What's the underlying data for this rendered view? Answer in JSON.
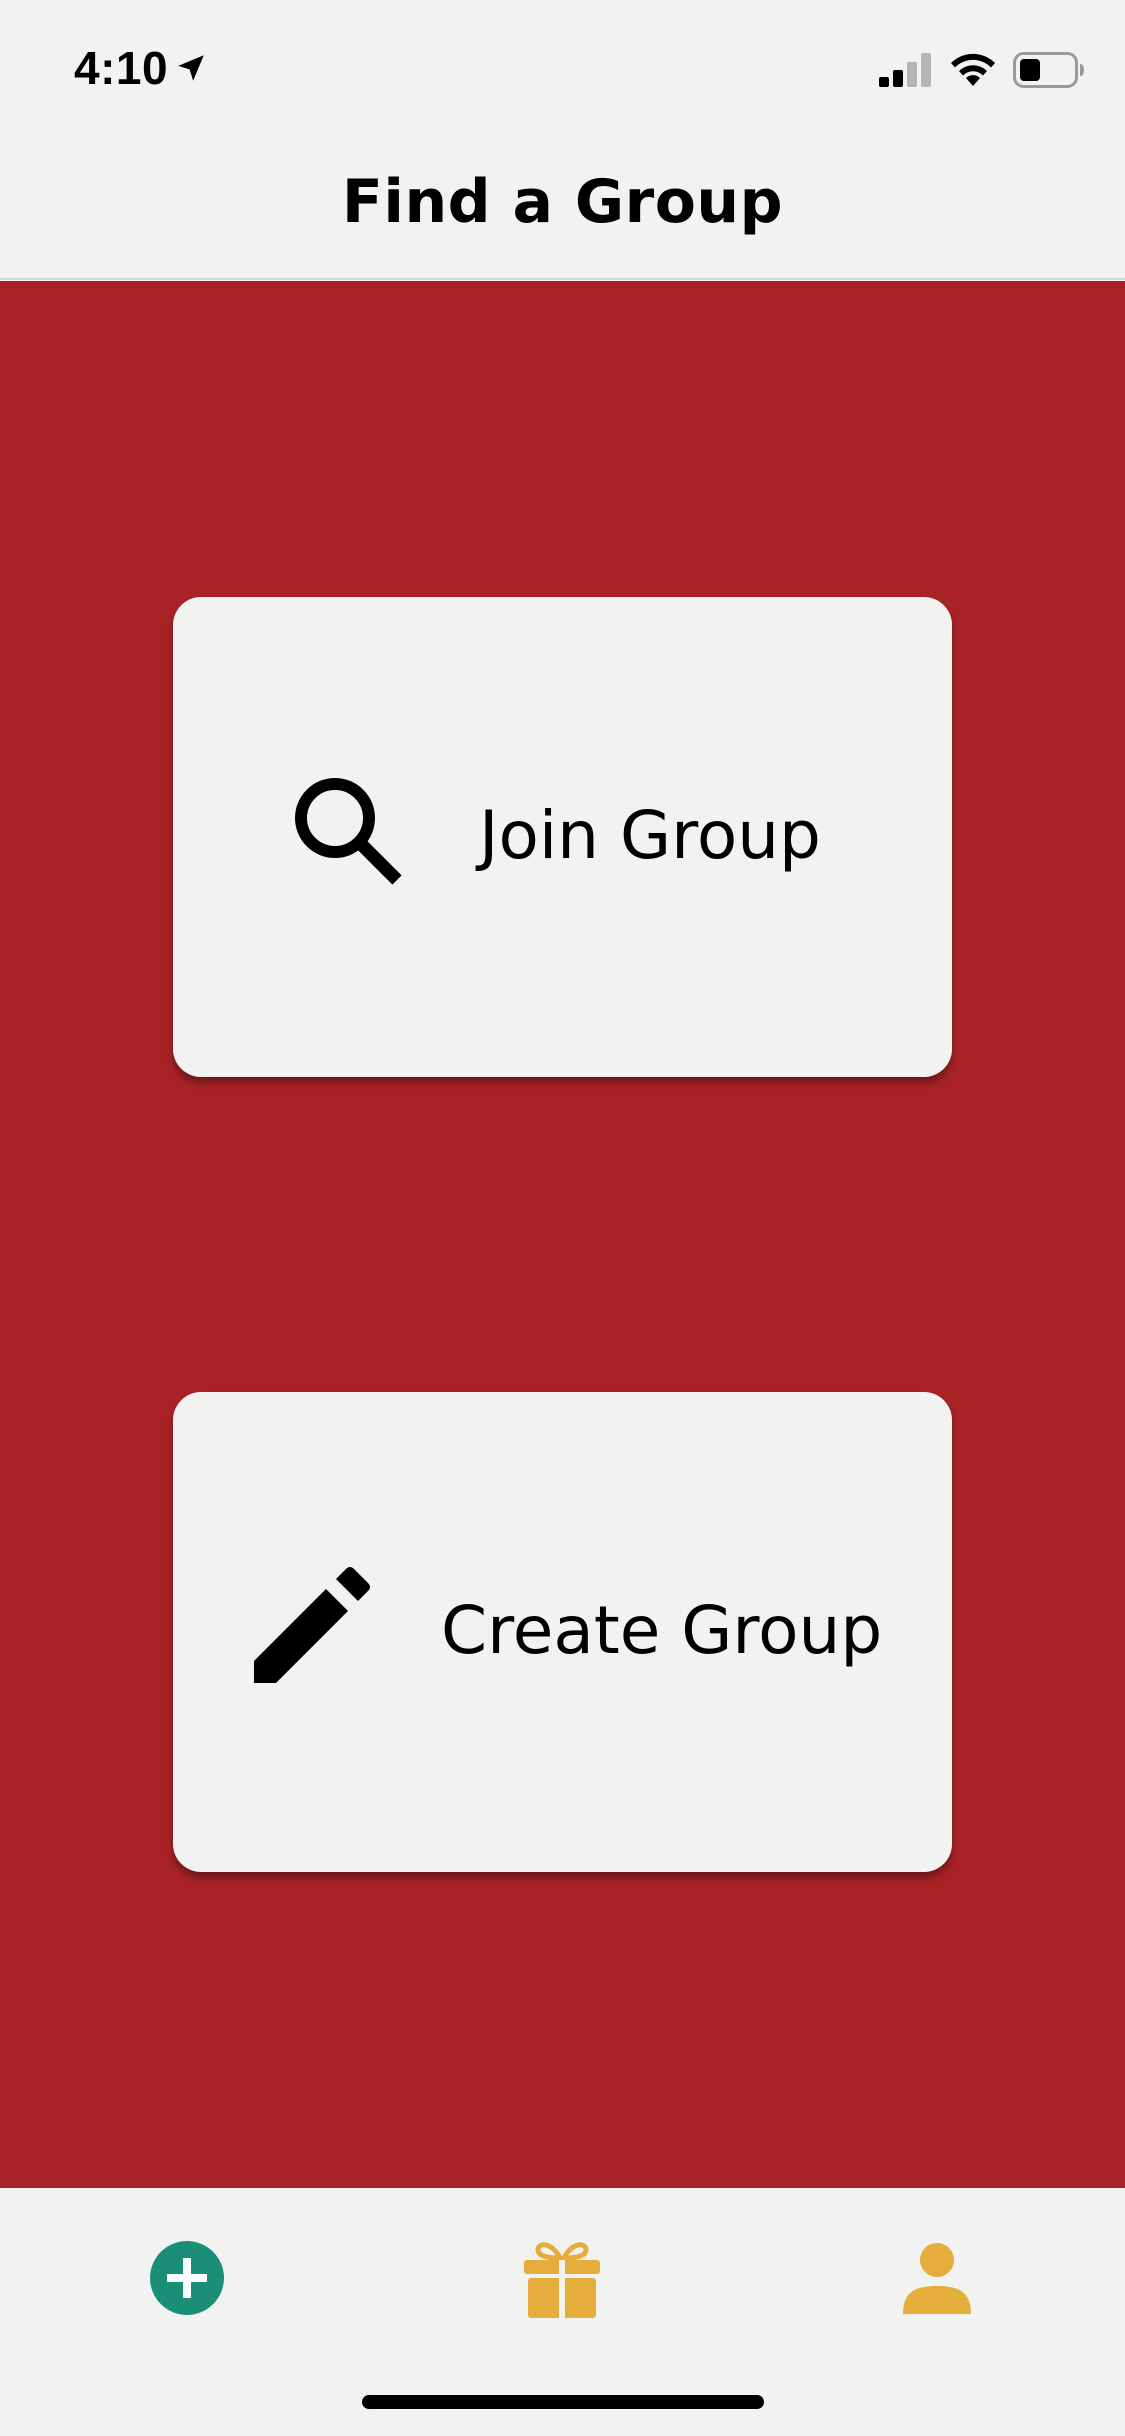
{
  "status_bar": {
    "time": "4:10",
    "icons": [
      "location-arrow-icon",
      "cellular-signal-icon",
      "wifi-icon",
      "battery-icon"
    ]
  },
  "header": {
    "title": "Find a Group"
  },
  "main": {
    "background_color": "#a92326",
    "cards": [
      {
        "label": "Join Group",
        "icon": "search-icon"
      },
      {
        "label": "Create Group",
        "icon": "pencil-icon"
      }
    ]
  },
  "tab_bar": {
    "tabs": [
      {
        "icon": "add-circle-icon",
        "color": "#1a8e77"
      },
      {
        "icon": "gift-icon",
        "color": "#e5ad3c"
      },
      {
        "icon": "person-icon",
        "color": "#e5ad3c"
      }
    ]
  }
}
